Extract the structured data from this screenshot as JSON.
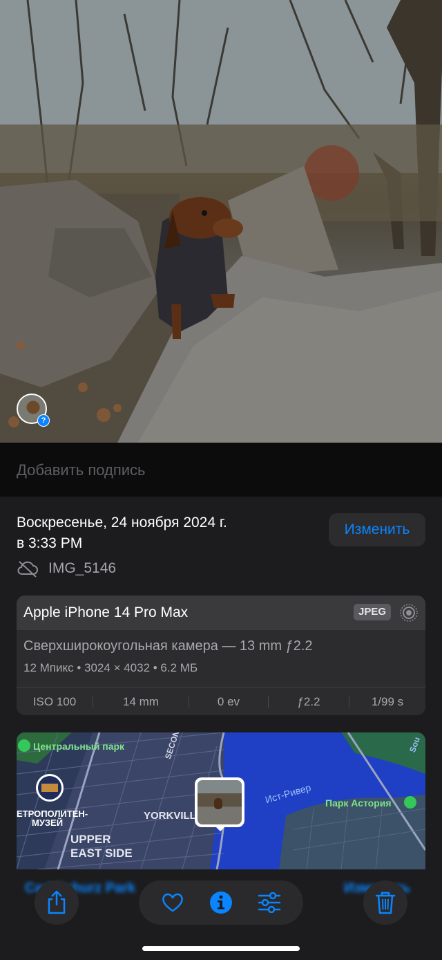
{
  "caption": {
    "placeholder": "Добавить подпись"
  },
  "details": {
    "date_line1": "Воскресенье, 24 ноября 2024 г.",
    "date_line2": "в 3:33 PM",
    "edit_label": "Изменить",
    "filename": "IMG_5146",
    "cloud_icon": "cloud-slash-icon"
  },
  "camera": {
    "model": "Apple iPhone 14 Pro Max",
    "format": "JPEG",
    "lens": "Сверхширокоугольная камера — 13 mm ƒ2.2",
    "specs": "12 Мпикс • 3024 × 4032 • 6.2 МБ",
    "exif": [
      "ISO 100",
      "14 mm",
      "0 ev",
      "ƒ2.2",
      "1/99 s"
    ]
  },
  "map": {
    "labels": {
      "central_park": "Центральный парк",
      "second_ave": "SECOND",
      "metropolitan": "ЕТРОПОЛИТЕН-",
      "museum": "МУЗЕЙ",
      "yorkville": "YORKVILLE",
      "upper": "UPPER",
      "east_side": "EAST SIDE",
      "east_river": "Ист-Ривер",
      "astoria_park": "Парк Астория",
      "edge": "Sou"
    }
  },
  "below_map": {
    "left": "Carl Schurz Park",
    "right": "Изменить"
  },
  "toolbar": {
    "share_icon": "share-icon",
    "favorite_icon": "heart-icon",
    "info_icon": "info-icon",
    "adjust_icon": "sliders-icon",
    "delete_icon": "trash-icon"
  },
  "colors": {
    "accent": "#0a84ff",
    "background": "#1c1c1e",
    "card": "#2c2c2e"
  }
}
